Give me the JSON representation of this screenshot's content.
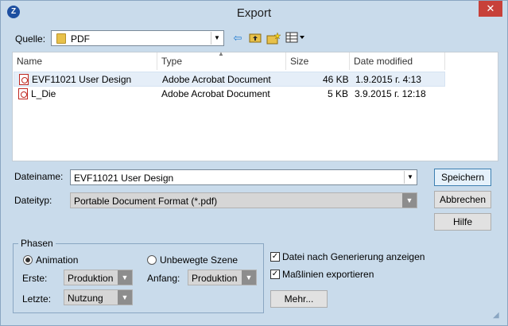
{
  "window": {
    "title": "Export",
    "close_glyph": "✕",
    "app_icon_letter": "Z"
  },
  "toolbar": {
    "source_label": "Quelle:",
    "source_value": "PDF",
    "icons": [
      "back-arrow-icon",
      "up-folder-icon",
      "new-folder-icon",
      "view-menu-icon"
    ]
  },
  "filelist": {
    "columns": [
      "Name",
      "Type",
      "Size",
      "Date modified"
    ],
    "rows": [
      {
        "name": "EVF11021 User Design",
        "type": "Adobe Acrobat Document",
        "size": "46 KB",
        "date": "1.9.2015 г. 4:13",
        "selected": true
      },
      {
        "name": "L_Die",
        "type": "Adobe Acrobat Document",
        "size": "5 KB",
        "date": "3.9.2015 г. 12:18",
        "selected": false
      }
    ]
  },
  "filename": {
    "label": "Dateiname:",
    "value": "EVF11021 User Design"
  },
  "filetype": {
    "label": "Dateityp:",
    "value": "Portable Document Format (*.pdf)"
  },
  "buttons": {
    "save": "Speichern",
    "cancel": "Abbrechen",
    "help": "Hilfe",
    "more": "Mehr..."
  },
  "phases": {
    "title": "Phasen",
    "animation_label": "Animation",
    "static_label": "Unbewegte Szene",
    "first_label": "Erste:",
    "first_value": "Produktion",
    "last_label": "Letzte:",
    "last_value": "Nutzung",
    "start_label": "Anfang:",
    "start_value": "Produktion",
    "selected_mode": "Animation"
  },
  "options": {
    "show_after_generation": {
      "label": "Datei nach Generierung anzeigen",
      "checked": true
    },
    "export_dimensions": {
      "label": "Maßlinien exportieren",
      "checked": true
    }
  },
  "colors": {
    "dialog_bg": "#c9dbeb",
    "close_button": "#c7413a",
    "selected_row": "#e5eef8",
    "pdf_red": "#c0271f"
  }
}
